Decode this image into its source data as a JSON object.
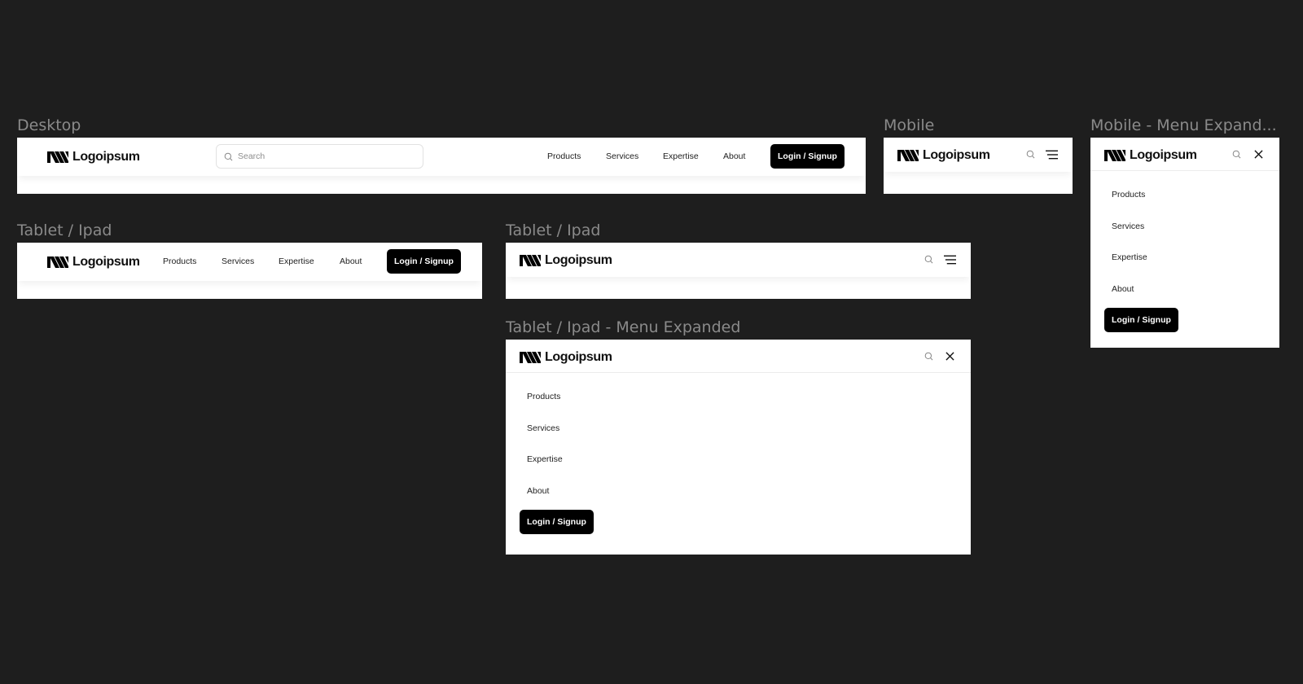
{
  "brand": {
    "name": "Logoipsum"
  },
  "colors": {
    "canvas_bg": "#1e1e1e",
    "frame_bg": "#ffffff",
    "label_text": "#8a8a8a",
    "primary_button_bg": "#000000",
    "primary_button_text": "#ffffff"
  },
  "nav": {
    "items": [
      "Products",
      "Services",
      "Expertise",
      "About"
    ],
    "cta_label": "Login / Signup"
  },
  "search": {
    "placeholder": "Search",
    "icon": "search-icon"
  },
  "icons": {
    "menu": "hamburger-menu-icon",
    "close": "close-icon",
    "search": "search-icon",
    "logo": "logo-mark-icon"
  },
  "frames": {
    "desktop": {
      "label": "Desktop"
    },
    "mobile": {
      "label": "Mobile"
    },
    "mobile_expanded": {
      "label": "Mobile - Menu Expand..."
    },
    "tablet_inline": {
      "label": "Tablet / Ipad"
    },
    "tablet_collapsed": {
      "label": "Tablet / Ipad"
    },
    "tablet_expanded": {
      "label": "Tablet / Ipad - Menu Expanded"
    }
  }
}
